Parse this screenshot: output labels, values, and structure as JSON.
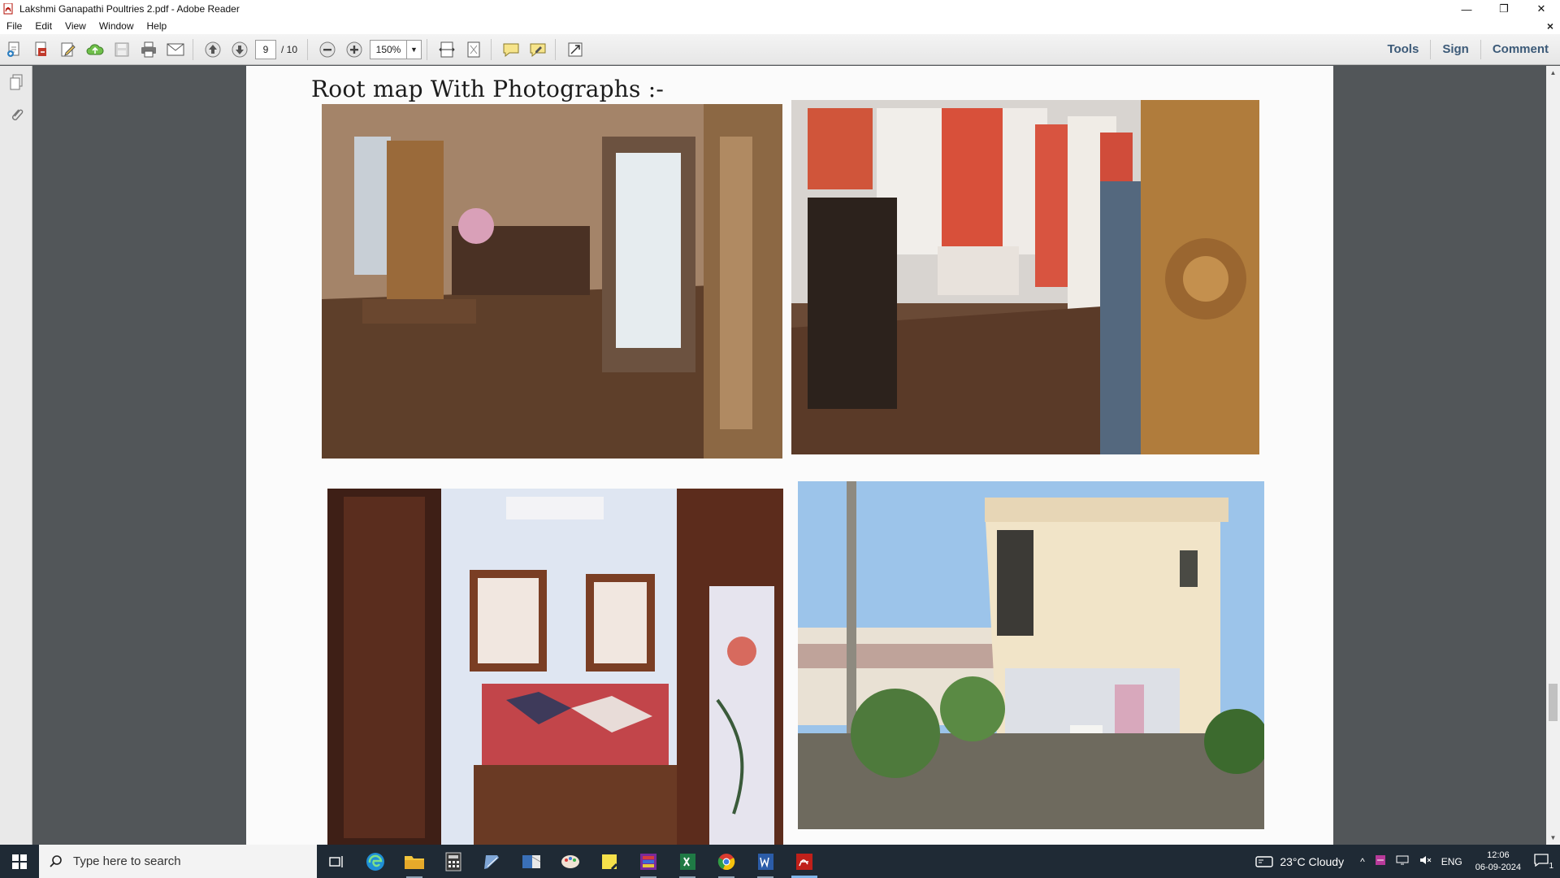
{
  "window": {
    "title": "Lakshmi Ganapathi Poultries 2.pdf - Adobe Reader",
    "minimize": "—",
    "restore": "❐",
    "close": "✕"
  },
  "menu": {
    "items": [
      "File",
      "Edit",
      "View",
      "Window",
      "Help"
    ],
    "doc_close": "×"
  },
  "toolbar": {
    "page_current": "9",
    "page_total": "/ 10",
    "zoom": "150%",
    "zoom_dropdown": "▼",
    "links": [
      "Tools",
      "Sign",
      "Comment"
    ]
  },
  "document": {
    "heading": "Root map With Photographs :-"
  },
  "scrollbar": {
    "up": "▲",
    "down": "▼"
  },
  "taskbar": {
    "search_placeholder": "Type here to search",
    "weather": "23°C  Cloudy",
    "language": "ENG",
    "time": "12:06",
    "date": "06-09-2024",
    "notification_count": "1"
  }
}
